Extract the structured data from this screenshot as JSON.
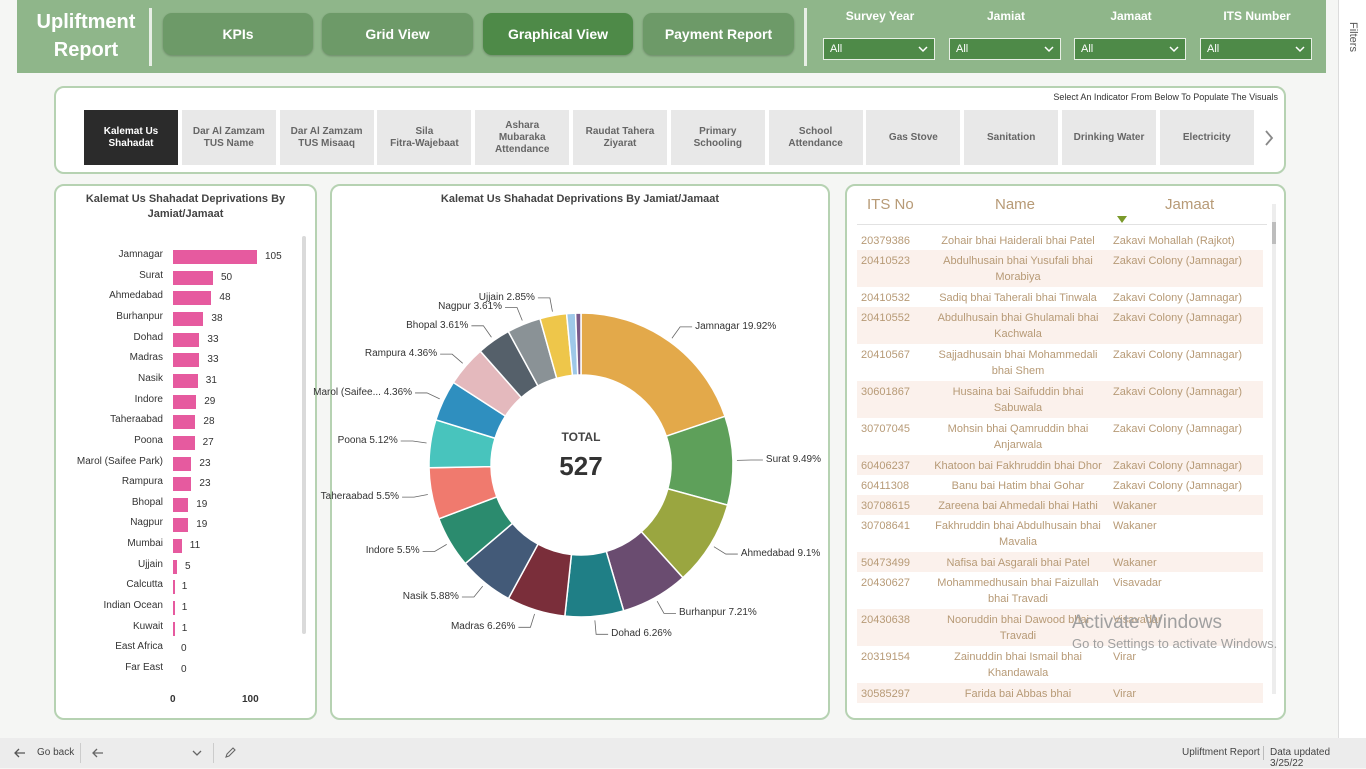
{
  "header": {
    "title_line1": "Upliftment",
    "title_line2": "Report",
    "nav": [
      "KPIs",
      "Grid View",
      "Graphical View",
      "Payment Report"
    ],
    "active_nav": "Graphical View",
    "filters": [
      {
        "label": "Survey Year",
        "value": "All"
      },
      {
        "label": "Jamiat",
        "value": "All"
      },
      {
        "label": "Jamaat",
        "value": "All"
      },
      {
        "label": "ITS Number",
        "value": "All"
      }
    ]
  },
  "side_panel": {
    "label": "Filters"
  },
  "indicators": {
    "hint": "Select An Indicator From Below To Populate The Visuals",
    "tiles": [
      "Kalemat Us\nShahadat",
      "Dar Al Zamzam\nTUS Name",
      "Dar Al Zamzam\nTUS Misaaq",
      "Sila\nFitra-Wajebaat",
      "Ashara\nMubaraka\nAttendance",
      "Raudat Tahera\nZiyarat",
      "Primary\nSchooling",
      "School\nAttendance",
      "Gas Stove",
      "Sanitation",
      "Drinking Water",
      "Electricity"
    ],
    "active_index": 0
  },
  "bar_chart": {
    "title": "Kalemat Us Shahadat Deprivations By Jamiat/Jamaat",
    "x_ticks": [
      "0",
      "100"
    ]
  },
  "donut": {
    "title": "Kalemat Us Shahadat Deprivations By Jamiat/Jamaat",
    "total_label": "TOTAL",
    "total_value": "527"
  },
  "chart_data": [
    {
      "type": "bar",
      "title": "Kalemat Us Shahadat Deprivations By Jamiat/Jamaat",
      "categories": [
        "Jamnagar",
        "Surat",
        "Ahmedabad",
        "Burhanpur",
        "Dohad",
        "Madras",
        "Nasik",
        "Indore",
        "Taheraabad",
        "Poona",
        "Marol (Saifee Park)",
        "Rampura",
        "Bhopal",
        "Nagpur",
        "Mumbai",
        "Ujjain",
        "Calcutta",
        "Indian Ocean",
        "Kuwait",
        "East Africa",
        "Far East"
      ],
      "values": [
        105,
        50,
        48,
        38,
        33,
        33,
        31,
        29,
        28,
        27,
        23,
        23,
        19,
        19,
        11,
        5,
        1,
        1,
        1,
        0,
        0
      ],
      "value_labels": [
        "105",
        "50",
        "48",
        "38",
        "33",
        "33",
        "31",
        "29",
        "28",
        "27",
        "23",
        "23",
        "19",
        "19",
        "11",
        "5",
        "1",
        "1",
        "1",
        "0",
        "0"
      ],
      "xlim": [
        0,
        100
      ]
    },
    {
      "type": "pie",
      "title": "Kalemat Us Shahadat Deprivations By Jamiat/Jamaat",
      "slices": [
        {
          "label": "Jamnagar 19.92%",
          "value": 19.92,
          "color": "#e3a94a"
        },
        {
          "label": "Surat 9.49%",
          "value": 9.49,
          "color": "#5ea05a"
        },
        {
          "label": "Ahmedabad 9.1%",
          "value": 9.1,
          "color": "#9aa640"
        },
        {
          "label": "Burhanpur 7.21%",
          "value": 7.21,
          "color": "#6a4c70"
        },
        {
          "label": "Dohad 6.26%",
          "value": 6.26,
          "color": "#1f7f86"
        },
        {
          "label": "Madras 6.26%",
          "value": 6.26,
          "color": "#7a2e3a"
        },
        {
          "label": "Nasik 5.88%",
          "value": 5.88,
          "color": "#435a78"
        },
        {
          "label": "Indore 5.5%",
          "value": 5.5,
          "color": "#2b8b6e"
        },
        {
          "label": "Taheraabad 5.5%",
          "value": 5.5,
          "color": "#f07a6e"
        },
        {
          "label": "Poona 5.12%",
          "value": 5.12,
          "color": "#48c4bd"
        },
        {
          "label": "Marol (Saifee... 4.36%",
          "value": 4.36,
          "color": "#2f8fbf"
        },
        {
          "label": "Rampura 4.36%",
          "value": 4.36,
          "color": "#e4b9bd"
        },
        {
          "label": "Bhopal 3.61%",
          "value": 3.61,
          "color": "#55606a"
        },
        {
          "label": "Nagpur 3.61%",
          "value": 3.61,
          "color": "#8a9296"
        },
        {
          "label": "Ujjain 2.85%",
          "value": 2.85,
          "color": "#eec64a"
        },
        {
          "label": "",
          "value": 0.95,
          "color": "#9ec8e8"
        },
        {
          "label": "",
          "value": 0.57,
          "color": "#7a5a8a"
        }
      ]
    }
  ],
  "table": {
    "columns": [
      "ITS No",
      "Name",
      "Jamaat"
    ],
    "rows": [
      [
        "20379386",
        "Zohair bhai Haiderali bhai Patel",
        "Zakavi Mohallah (Rajkot)"
      ],
      [
        "20410523",
        "Abdulhusain bhai Yusufali bhai Morabiya",
        "Zakavi Colony (Jamnagar)"
      ],
      [
        "20410532",
        "Sadiq bhai Taherali bhai Tinwala",
        "Zakavi Colony (Jamnagar)"
      ],
      [
        "20410552",
        "Abdulhusain bhai Ghulamali bhai Kachwala",
        "Zakavi Colony (Jamnagar)"
      ],
      [
        "20410567",
        "Sajjadhusain bhai Mohammedali bhai Shem",
        "Zakavi Colony (Jamnagar)"
      ],
      [
        "30601867",
        "Husaina bai Saifuddin bhai Sabuwala",
        "Zakavi Colony (Jamnagar)"
      ],
      [
        "30707045",
        "Mohsin bhai Qamruddin bhai Anjarwala",
        "Zakavi Colony (Jamnagar)"
      ],
      [
        "60406237",
        "Khatoon bai Fakhruddin bhai Dhor",
        "Zakavi Colony (Jamnagar)"
      ],
      [
        "60411308",
        "Banu bai Hatim bhai Gohar",
        "Zakavi Colony (Jamnagar)"
      ],
      [
        "30708615",
        "Zareena bai Ahmedali bhai Hathi",
        "Wakaner"
      ],
      [
        "30708641",
        "Fakhruddin bhai Abdulhusain bhai Mavalia",
        "Wakaner"
      ],
      [
        "50473499",
        "Nafisa bai Asgarali bhai Patel",
        "Wakaner"
      ],
      [
        "20430627",
        "Mohammedhusain bhai Faizullah bhai Travadi",
        "Visavadar"
      ],
      [
        "20430638",
        "Nooruddin bhai Dawood bhai Travadi",
        "Visavadar"
      ],
      [
        "20319154",
        "Zainuddin bhai Ismail bhai Khandawala",
        "Virar"
      ],
      [
        "30585297",
        "Farida bai Abbas bhai",
        "Virar"
      ]
    ]
  },
  "watermark": {
    "line1": "Activate Windows",
    "line2": "Go to Settings to activate Windows."
  },
  "footer": {
    "back": "Go back",
    "page_name": "Upliftment Report",
    "data_updated": "Data updated 3/25/22"
  },
  "colors": {
    "header": "#8fb68a",
    "nav_button": "#6d9a68",
    "nav_active": "#4e8a48",
    "bar": "#e65a9f",
    "table_text": "#b79a76"
  }
}
